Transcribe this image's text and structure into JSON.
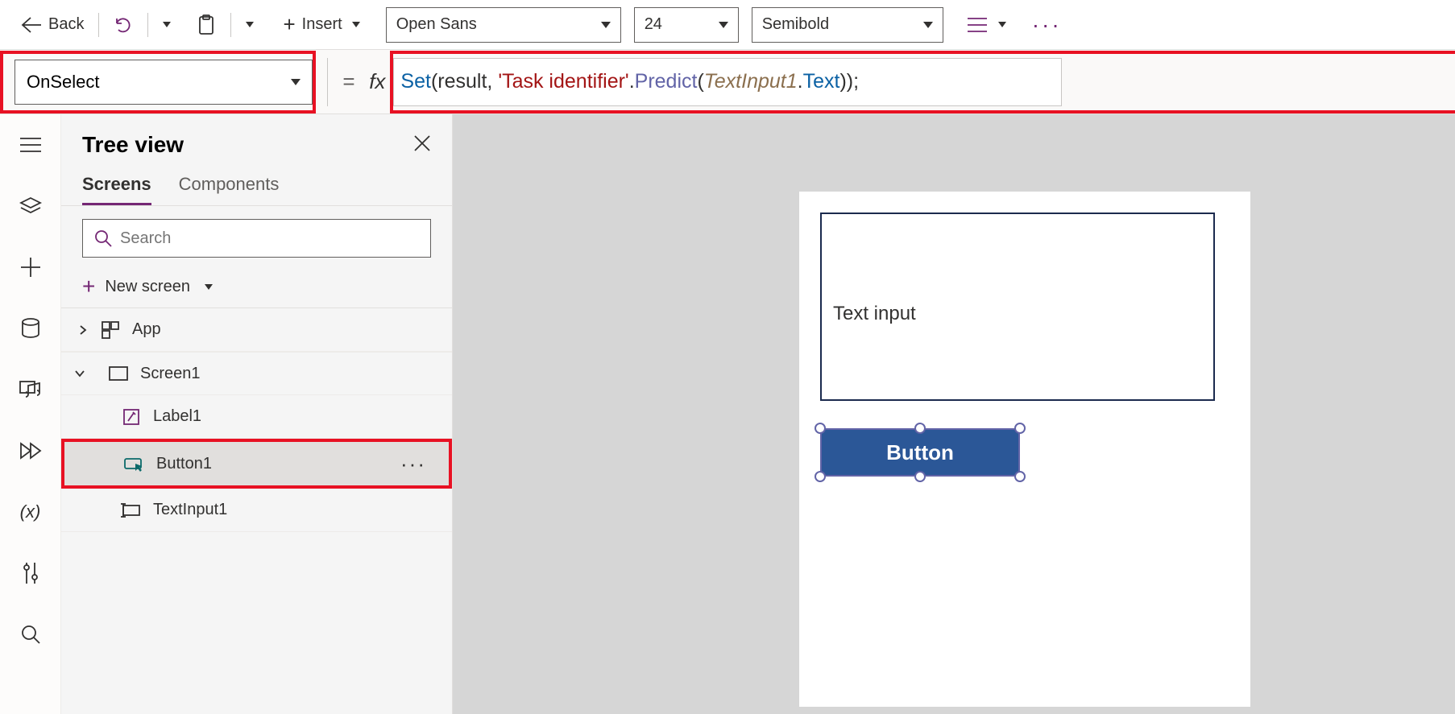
{
  "toolbar": {
    "back_label": "Back",
    "insert_label": "Insert",
    "font_family": "Open Sans",
    "font_size": "24",
    "font_weight": "Semibold"
  },
  "formula_bar": {
    "property": "OnSelect",
    "tokens": {
      "set": "Set",
      "open": "(result, ",
      "str": "'Task identifier'",
      "dot1": ".",
      "predict": "Predict",
      "open2": "(",
      "obj": "TextInput1",
      "dot2": ".",
      "prop": "Text",
      "close": "));"
    }
  },
  "tree": {
    "title": "Tree view",
    "tabs": {
      "screens": "Screens",
      "components": "Components"
    },
    "search_placeholder": "Search",
    "new_screen_label": "New screen",
    "items": {
      "app": "App",
      "screen1": "Screen1",
      "label1": "Label1",
      "button1": "Button1",
      "textinput1": "TextInput1"
    }
  },
  "canvas": {
    "text_input_placeholder": "Text input",
    "button_label": "Button"
  }
}
